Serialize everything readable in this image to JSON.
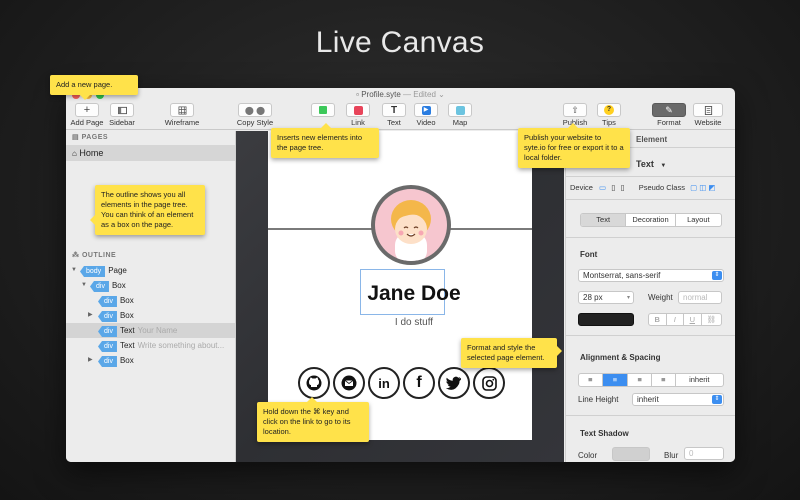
{
  "headline": "Live Canvas",
  "window": {
    "file_name": "Profile.syte",
    "status": "— Edited ⌄"
  },
  "toolbar": {
    "add_page": "Add Page",
    "sidebar": "Sidebar",
    "wireframe": "Wireframe",
    "copy_style": "Copy Style",
    "link": "Link",
    "text": "Text",
    "video": "Video",
    "map": "Map",
    "publish": "Publish",
    "tips": "Tips",
    "format": "Format",
    "website": "Website"
  },
  "sidebar": {
    "pages_heading": "PAGES",
    "home": "Home",
    "outline_heading": "OUTLINE",
    "tree": [
      {
        "tag": "body",
        "label": "Page",
        "hint": ""
      },
      {
        "tag": "div",
        "label": "Box",
        "hint": ""
      },
      {
        "tag": "div",
        "label": "Box",
        "hint": ""
      },
      {
        "tag": "div",
        "label": "Box",
        "hint": ""
      },
      {
        "tag": "div",
        "label": "Text",
        "hint": "Your Name"
      },
      {
        "tag": "div",
        "label": "Text",
        "hint": "Write something about..."
      },
      {
        "tag": "div",
        "label": "Box",
        "hint": ""
      }
    ]
  },
  "canvas": {
    "name": "Jane Doe",
    "tagline": "I do stuff",
    "socials": [
      "github-icon",
      "mail-icon",
      "linkedin-icon",
      "facebook-icon",
      "twitter-icon",
      "instagram-icon"
    ]
  },
  "inspector": {
    "element_label": "Element",
    "element_type": "Text",
    "element_type_arrow": "▼",
    "device_label": "Device",
    "pseudo_class_label": "Pseudo Class",
    "tabs": [
      "Text",
      "Decoration",
      "Layout"
    ],
    "font_heading": "Font",
    "font_family": "Montserrat, sans-serif",
    "font_size": "28 px",
    "weight_label": "Weight",
    "weight_value": "normal",
    "style_buttons": [
      "B",
      "I",
      "U",
      "S"
    ],
    "align_heading": "Alignment & Spacing",
    "align_inherit": "inherit",
    "line_height_label": "Line Height",
    "line_height_value": "inherit",
    "shadow_heading": "Text Shadow",
    "color_label": "Color",
    "blur_label": "Blur",
    "blur_value": "0",
    "text_color": "#222222"
  },
  "notes": {
    "add_page": "Add a new page.",
    "inserts": "Inserts new elements into the page tree.",
    "publish": "Publish your website to syte.io for free or export it to a local folder.",
    "outline": "The outline shows you all elements in the page tree. You can think of an element as a box on the page.",
    "format": "Format and style the selected page element.",
    "hold": "Hold down the ⌘ key and click on the link to go to its location."
  },
  "colors": {
    "note_yellow": "#ffe24a",
    "tag_blue": "#5aa7e8",
    "accent_blue": "#3c8ef0"
  }
}
